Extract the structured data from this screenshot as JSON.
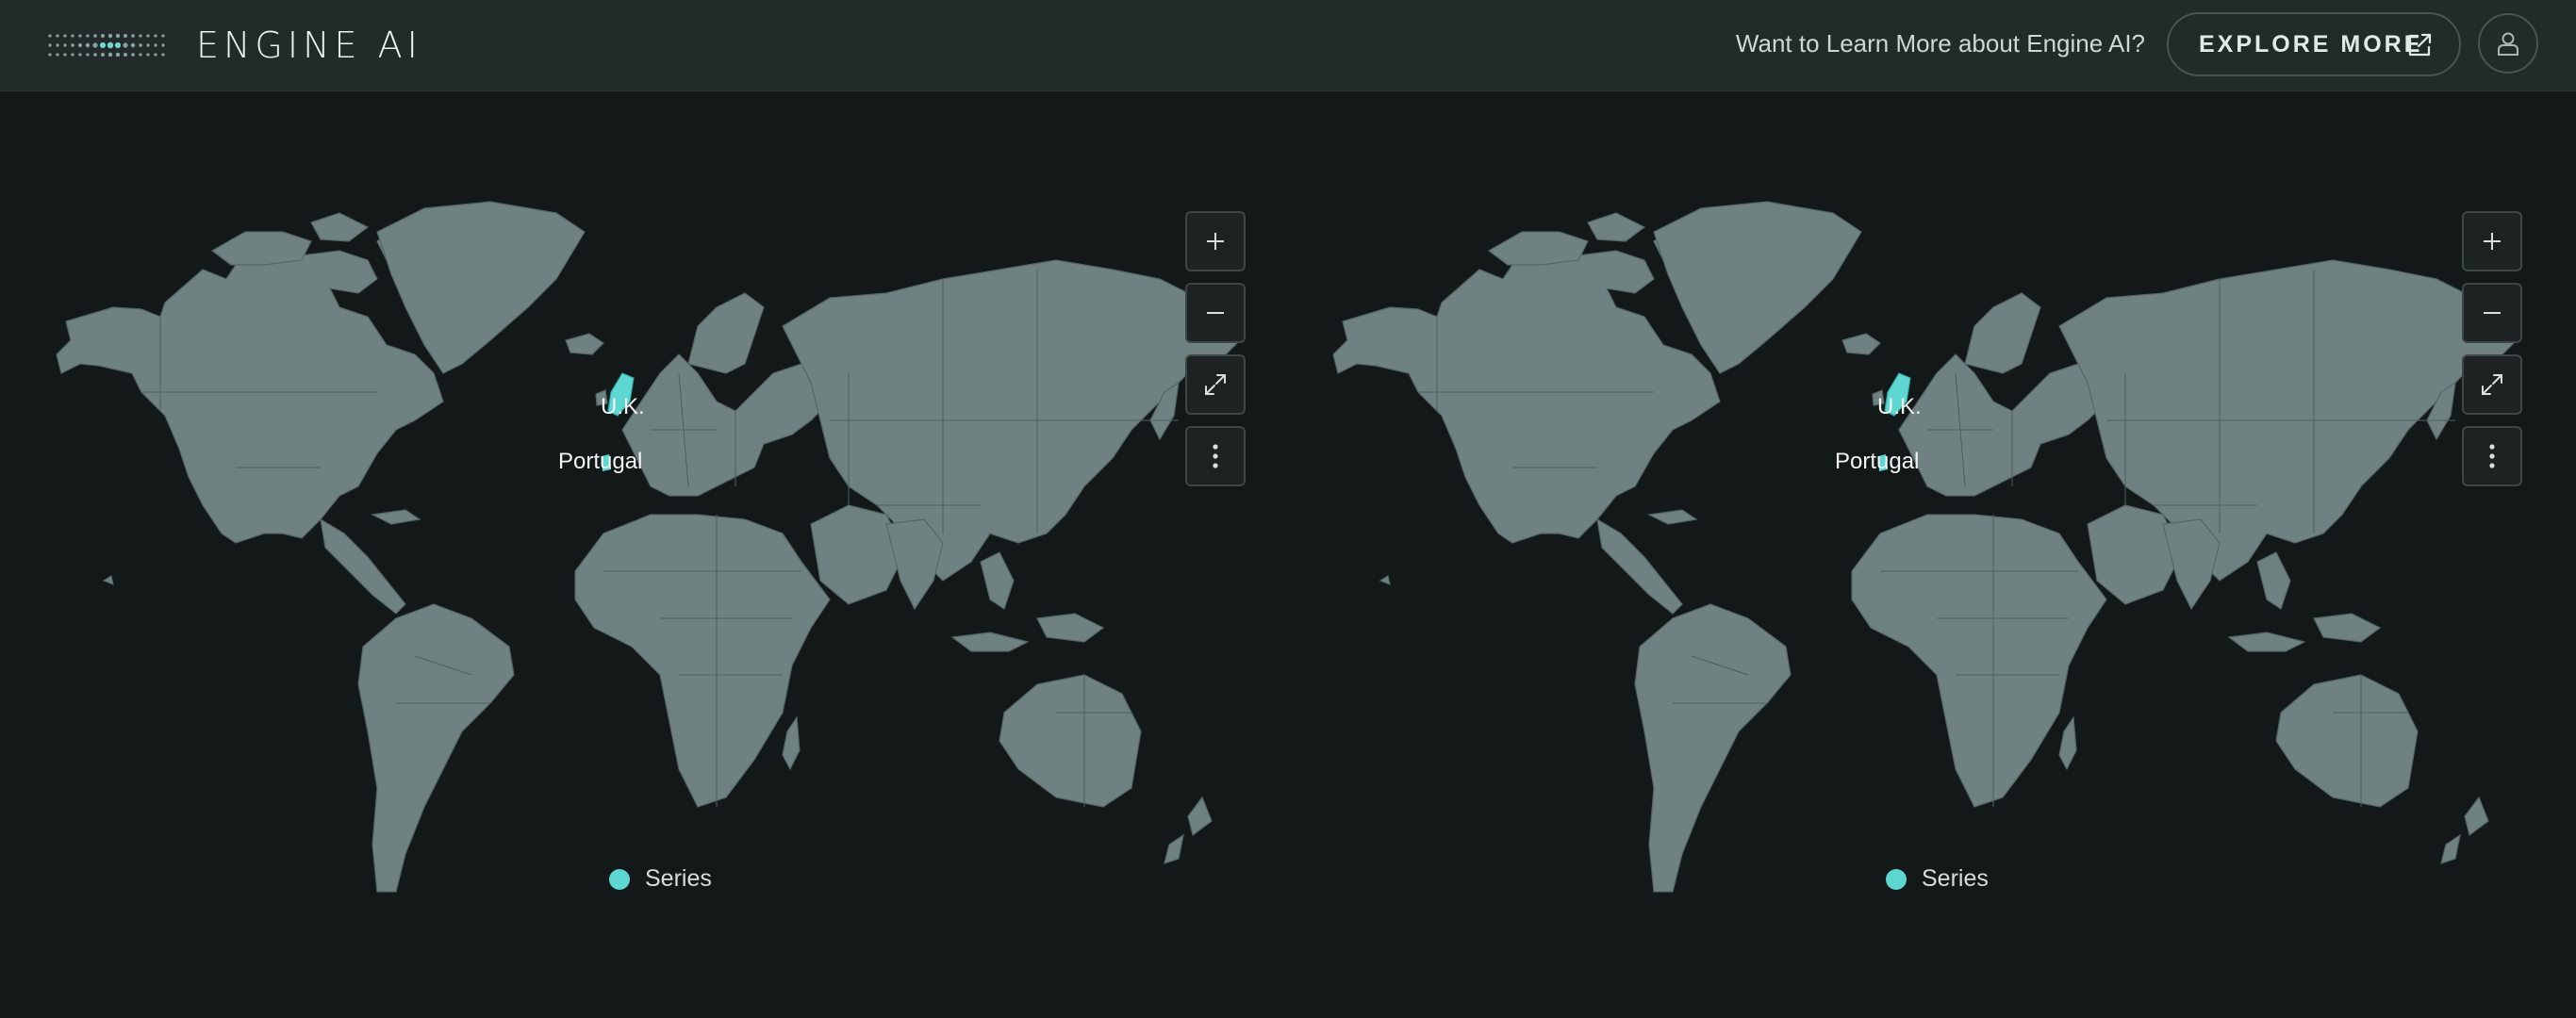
{
  "header": {
    "brand": "ENGINE AI",
    "promo_text": "Want to Learn More about Engine AI?",
    "explore_label": "EXPLORE MORE"
  },
  "colors": {
    "background": "#131918",
    "header": "#232b2a",
    "land": "#6f8281",
    "borders": "#48595a",
    "highlight": "#5ed6d2"
  },
  "maps": [
    {
      "labels": {
        "uk": "U.K.",
        "portugal": "Portugal"
      },
      "legend": "Series",
      "controls": [
        "zoom-in",
        "zoom-out",
        "fullscreen",
        "more"
      ]
    },
    {
      "labels": {
        "uk": "U.K.",
        "portugal": "Portugal"
      },
      "legend": "Series",
      "controls": [
        "zoom-in",
        "zoom-out",
        "fullscreen",
        "more"
      ]
    }
  ]
}
